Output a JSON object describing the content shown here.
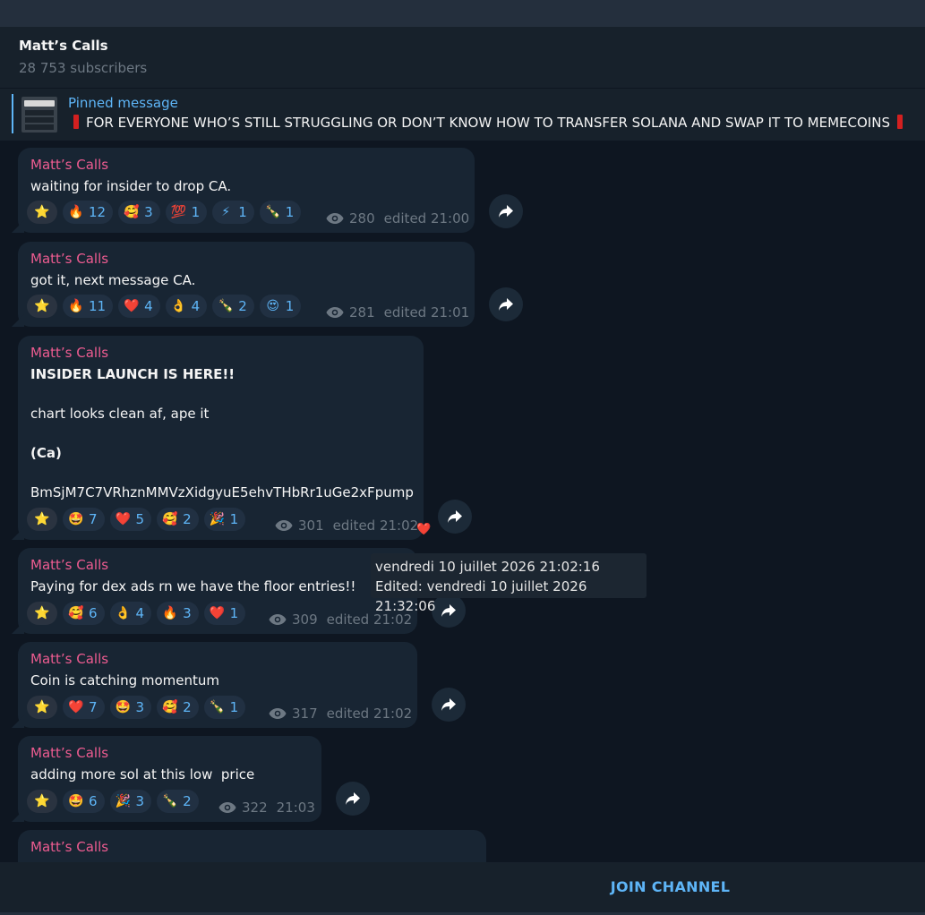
{
  "header": {
    "title": "Matt’s Calls",
    "subscribers": "28 753 subscribers"
  },
  "pinned": {
    "label": "Pinned message",
    "text": "FOR EVERYONE WHO’S STILL STRUGGLING OR DON’T KNOW HOW TO TRANSFER SOLANA AND SWAP IT TO MEMECOINS"
  },
  "messages": [
    {
      "author": "Matt’s Calls",
      "text": "waiting for insider to drop CA.",
      "reactions": [
        {
          "e": "🔥",
          "c": "12"
        },
        {
          "e": "🥰",
          "c": "3"
        },
        {
          "e": "💯",
          "c": "1"
        },
        {
          "e": "⚡",
          "c": "1"
        },
        {
          "e": "🍾",
          "c": "1"
        }
      ],
      "views": "280",
      "time": "edited 21:00"
    },
    {
      "author": "Matt’s Calls",
      "text": "got it, next message CA.",
      "reactions": [
        {
          "e": "🔥",
          "c": "11"
        },
        {
          "e": "❤️",
          "c": "4"
        },
        {
          "e": "👌",
          "c": "4"
        },
        {
          "e": "🍾",
          "c": "2"
        },
        {
          "e": "😍",
          "c": "1"
        }
      ],
      "views": "281",
      "time": "edited 21:01"
    },
    {
      "author": "Matt’s Calls",
      "text_line1": "INSIDER LAUNCH IS HERE!!",
      "text_line2": "chart looks clean af, ape it",
      "text_line3": "(Ca)",
      "text_line4": "BmSjM7C7VRhznMMVzXidgyuE5ehvTHbRr1uGe2xFpump",
      "reactions": [
        {
          "e": "🤩",
          "c": "7"
        },
        {
          "e": "❤️",
          "c": "5"
        },
        {
          "e": "🥰",
          "c": "2"
        },
        {
          "e": "🎉",
          "c": "1"
        }
      ],
      "views": "301",
      "time": "edited 21:02"
    },
    {
      "author": "Matt’s Calls",
      "text": "Paying for dex ads rn we have the floor entries!!",
      "reactions": [
        {
          "e": "🥰",
          "c": "6"
        },
        {
          "e": "👌",
          "c": "4"
        },
        {
          "e": "🔥",
          "c": "3"
        },
        {
          "e": "❤️",
          "c": "1"
        }
      ],
      "views": "309",
      "time": "edited 21:02"
    },
    {
      "author": "Matt’s Calls",
      "text": "Coin is catching momentum",
      "reactions": [
        {
          "e": "❤️",
          "c": "7"
        },
        {
          "e": "🤩",
          "c": "3"
        },
        {
          "e": "🥰",
          "c": "2"
        },
        {
          "e": "🍾",
          "c": "1"
        }
      ],
      "views": "317",
      "time": "edited 21:02"
    },
    {
      "author": "Matt’s Calls",
      "text": "adding more sol at this low  price",
      "reactions": [
        {
          "e": "🤩",
          "c": "6"
        },
        {
          "e": "🎉",
          "c": "3"
        },
        {
          "e": "🍾",
          "c": "2"
        }
      ],
      "views": "322",
      "time": "21:03"
    },
    {
      "author": "Matt’s Calls"
    }
  ],
  "tooltip": {
    "line1": "vendredi 10 juillet 2026 21:02:16",
    "line2": "Edited: vendredi 10 juillet 2026 21:32:06"
  },
  "star_emoji": "⭐",
  "float_heart": "❤️",
  "join_label": "JOIN CHANNEL",
  "colors": {
    "accent": "#5eb5f7",
    "author": "#ee5c91",
    "bubble": "#182533",
    "background": "#0e1621"
  }
}
